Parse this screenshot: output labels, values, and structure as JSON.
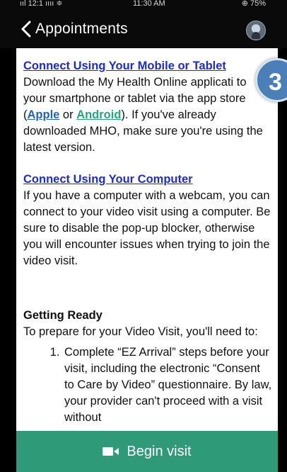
{
  "status_bar": {
    "carrier": "ııl 12:1 ıııı ≑",
    "time": "11:30 AM",
    "battery": "⊕ 75%"
  },
  "nav": {
    "title": "Appointments",
    "back_icon": "chevron-left-icon",
    "avatar_icon": "user-avatar"
  },
  "content": {
    "mobile_link": "Connect Using Your Mobile or Tablet",
    "mobile_text_1": "Download the My Health Online applicati",
    "mobile_text_2": "to your smartphone or tablet via the app store (",
    "apple_link": "Apple",
    "or_text": " or ",
    "android_link": "Android",
    "mobile_text_3": "). If you've already downloaded MHO, make sure you're using the latest version.",
    "computer_link": "Connect Using Your Computer",
    "computer_text": "If you have a computer with a webcam, you can connect to your video visit using a computer. Be sure to disable the pop-up blocker, otherwise you will encounter issues when trying to join the video visit.",
    "getting_ready_heading": "Getting Ready",
    "getting_ready_text": "To prepare for your Video Visit, you'll need to:",
    "steps": [
      "Complete “EZ Arrival” steps before your visit, including the electronic “Consent to Care by Video” questionnaire. By law, your provider can't proceed with a visit without"
    ]
  },
  "badge": {
    "label": "3"
  },
  "begin_button": {
    "label": "Begin visit",
    "icon": "video-camera-icon"
  },
  "colors": {
    "link": "#1d2bd6",
    "apple": "#1d64c8",
    "android": "#23a87c",
    "button": "#2f9a78",
    "badge": "#4a7fb8"
  }
}
